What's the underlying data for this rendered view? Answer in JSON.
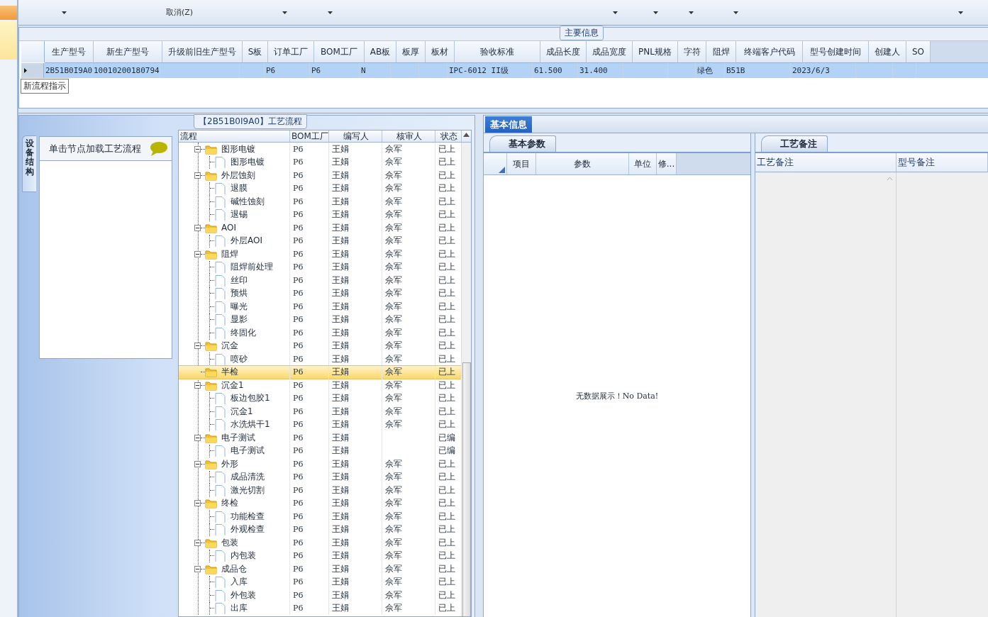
{
  "toolbar": {
    "cancel_label": "取消(Z)"
  },
  "main_info": {
    "title": "主要信息",
    "tooltip": "新流程指示",
    "columns": [
      "生产型号",
      "新生产型号",
      "升级前旧生产型号",
      "S板",
      "订单工厂",
      "BOM工厂",
      "AB板",
      "板厚",
      "板材",
      "验收标准",
      "成品长度",
      "成品宽度",
      "PNL规格",
      "字符",
      "阻焊",
      "终端客户代码",
      "型号创建时间",
      "创建人",
      "SO"
    ],
    "rows": [
      {
        "selected": true,
        "cells": [
          "2B51B0I9A0",
          "10010200180794",
          "",
          "",
          "P6",
          "P6",
          "N",
          "",
          "",
          "IPC-6012 II级",
          "61.500",
          "31.400",
          "",
          "",
          "绿色",
          "B51B",
          "2023/6/3",
          "",
          ""
        ]
      }
    ]
  },
  "process_panel": {
    "title": "【2B51B0I9A0】工艺流程",
    "side_tab": "设备结构",
    "nav_hint": "单击节点加载工艺流程",
    "tree_columns": [
      "流程",
      "BOM工厂",
      "编写人",
      "核审人",
      "状态"
    ],
    "tree": [
      {
        "kind": "folder",
        "name": "图形电镀",
        "bom": "P6",
        "writer": "王娟",
        "reviewer": "佘军",
        "status": "已上",
        "selected": false,
        "expanded": true,
        "children": [
          {
            "kind": "file",
            "name": "图形电镀",
            "bom": "P6",
            "writer": "王娟",
            "reviewer": "佘军",
            "status": "已上",
            "selected": false
          }
        ]
      },
      {
        "kind": "folder",
        "name": "外层蚀刻",
        "bom": "P6",
        "writer": "王娟",
        "reviewer": "佘军",
        "status": "已上",
        "selected": false,
        "expanded": true,
        "children": [
          {
            "kind": "file",
            "name": "退膜",
            "bom": "P6",
            "writer": "王娟",
            "reviewer": "佘军",
            "status": "已上",
            "selected": false
          },
          {
            "kind": "file",
            "name": "碱性蚀刻",
            "bom": "P6",
            "writer": "王娟",
            "reviewer": "佘军",
            "status": "已上",
            "selected": false
          },
          {
            "kind": "file",
            "name": "退锡",
            "bom": "P6",
            "writer": "王娟",
            "reviewer": "佘军",
            "status": "已上",
            "selected": false
          }
        ]
      },
      {
        "kind": "folder",
        "name": "AOI",
        "bom": "P6",
        "writer": "王娟",
        "reviewer": "佘军",
        "status": "已上",
        "selected": false,
        "expanded": true,
        "children": [
          {
            "kind": "file",
            "name": "外层AOI",
            "bom": "P6",
            "writer": "王娟",
            "reviewer": "佘军",
            "status": "已上",
            "selected": false
          }
        ]
      },
      {
        "kind": "folder",
        "name": "阻焊",
        "bom": "P6",
        "writer": "王娟",
        "reviewer": "佘军",
        "status": "已上",
        "selected": false,
        "expanded": true,
        "children": [
          {
            "kind": "file",
            "name": "阻焊前处理",
            "bom": "P6",
            "writer": "王娟",
            "reviewer": "佘军",
            "status": "已上",
            "selected": false
          },
          {
            "kind": "file",
            "name": "丝印",
            "bom": "P6",
            "writer": "王娟",
            "reviewer": "佘军",
            "status": "已上",
            "selected": false
          },
          {
            "kind": "file",
            "name": "预烘",
            "bom": "P6",
            "writer": "王娟",
            "reviewer": "佘军",
            "status": "已上",
            "selected": false
          },
          {
            "kind": "file",
            "name": "曝光",
            "bom": "P6",
            "writer": "王娟",
            "reviewer": "佘军",
            "status": "已上",
            "selected": false
          },
          {
            "kind": "file",
            "name": "显影",
            "bom": "P6",
            "writer": "王娟",
            "reviewer": "佘军",
            "status": "已上",
            "selected": false
          },
          {
            "kind": "file",
            "name": "终固化",
            "bom": "P6",
            "writer": "王娟",
            "reviewer": "佘军",
            "status": "已上",
            "selected": false
          }
        ]
      },
      {
        "kind": "folder",
        "name": "沉金",
        "bom": "P6",
        "writer": "王娟",
        "reviewer": "佘军",
        "status": "已上",
        "selected": false,
        "expanded": true,
        "children": [
          {
            "kind": "file",
            "name": "喷砂",
            "bom": "P6",
            "writer": "王娟",
            "reviewer": "佘军",
            "status": "已上",
            "selected": false
          }
        ]
      },
      {
        "kind": "folder",
        "name": "半检",
        "bom": "P6",
        "writer": "王娟",
        "reviewer": "佘军",
        "status": "已上",
        "selected": true
      },
      {
        "kind": "folder",
        "name": "沉金1",
        "bom": "P6",
        "writer": "王娟",
        "reviewer": "佘军",
        "status": "已上",
        "selected": false,
        "expanded": true,
        "children": [
          {
            "kind": "file",
            "name": "板边包胶1",
            "bom": "P6",
            "writer": "王娟",
            "reviewer": "佘军",
            "status": "已上",
            "selected": false
          },
          {
            "kind": "file",
            "name": "沉金1",
            "bom": "P6",
            "writer": "王娟",
            "reviewer": "佘军",
            "status": "已上",
            "selected": false
          },
          {
            "kind": "file",
            "name": "水洗烘干1",
            "bom": "P6",
            "writer": "王娟",
            "reviewer": "佘军",
            "status": "已上",
            "selected": false
          }
        ]
      },
      {
        "kind": "folder",
        "name": "电子测试",
        "bom": "P6",
        "writer": "王娟",
        "status": "已编",
        "selected": false,
        "expanded": true,
        "children": [
          {
            "kind": "file",
            "name": "电子测试",
            "bom": "P6",
            "writer": "王娟",
            "status": "已编",
            "selected": false
          }
        ]
      },
      {
        "kind": "folder",
        "name": "外形",
        "bom": "P6",
        "writer": "王娟",
        "reviewer": "佘军",
        "status": "已上",
        "selected": false,
        "expanded": true,
        "children": [
          {
            "kind": "file",
            "name": "成品清洗",
            "bom": "P6",
            "writer": "王娟",
            "reviewer": "佘军",
            "status": "已上",
            "selected": false
          },
          {
            "kind": "file",
            "name": "激光切割",
            "bom": "P6",
            "writer": "王娟",
            "reviewer": "佘军",
            "status": "已上",
            "selected": false
          }
        ]
      },
      {
        "kind": "folder",
        "name": "终检",
        "bom": "P6",
        "writer": "王娟",
        "reviewer": "佘军",
        "status": "已上",
        "selected": false,
        "expanded": true,
        "children": [
          {
            "kind": "file",
            "name": "功能检查",
            "bom": "P6",
            "writer": "王娟",
            "reviewer": "佘军",
            "status": "已上",
            "selected": false
          },
          {
            "kind": "file",
            "name": "外观检查",
            "bom": "P6",
            "writer": "王娟",
            "reviewer": "佘军",
            "status": "已上",
            "selected": false
          }
        ]
      },
      {
        "kind": "folder",
        "name": "包装",
        "bom": "P6",
        "writer": "王娟",
        "reviewer": "佘军",
        "status": "已上",
        "selected": false,
        "expanded": true,
        "children": [
          {
            "kind": "file",
            "name": "内包装",
            "bom": "P6",
            "writer": "王娟",
            "reviewer": "佘军",
            "status": "已上",
            "selected": false
          }
        ]
      },
      {
        "kind": "folder",
        "name": "成品仓",
        "bom": "P6",
        "writer": "王娟",
        "reviewer": "佘军",
        "status": "已上",
        "selected": false,
        "expanded": true,
        "children": [
          {
            "kind": "file",
            "name": "入库",
            "bom": "P6",
            "writer": "王娟",
            "reviewer": "佘军",
            "status": "已上",
            "selected": false
          },
          {
            "kind": "file",
            "name": "外包装",
            "bom": "P6",
            "writer": "王娟",
            "reviewer": "佘军",
            "status": "已上",
            "selected": false
          },
          {
            "kind": "file",
            "name": "出库",
            "bom": "P6",
            "writer": "王娟",
            "reviewer": "佘军",
            "status": "已上",
            "selected": false
          }
        ]
      }
    ]
  },
  "detail_panel": {
    "tabs": [
      {
        "label": "基本信息",
        "selected": true
      }
    ],
    "params": {
      "tab": "基本参数",
      "columns": [
        "项目",
        "参数",
        "单位",
        "修..."
      ],
      "empty_text": "无数据展示！No Data!"
    },
    "notes": {
      "tab": "工艺备注",
      "columns": [
        "工艺备注",
        "型号备注"
      ]
    }
  }
}
